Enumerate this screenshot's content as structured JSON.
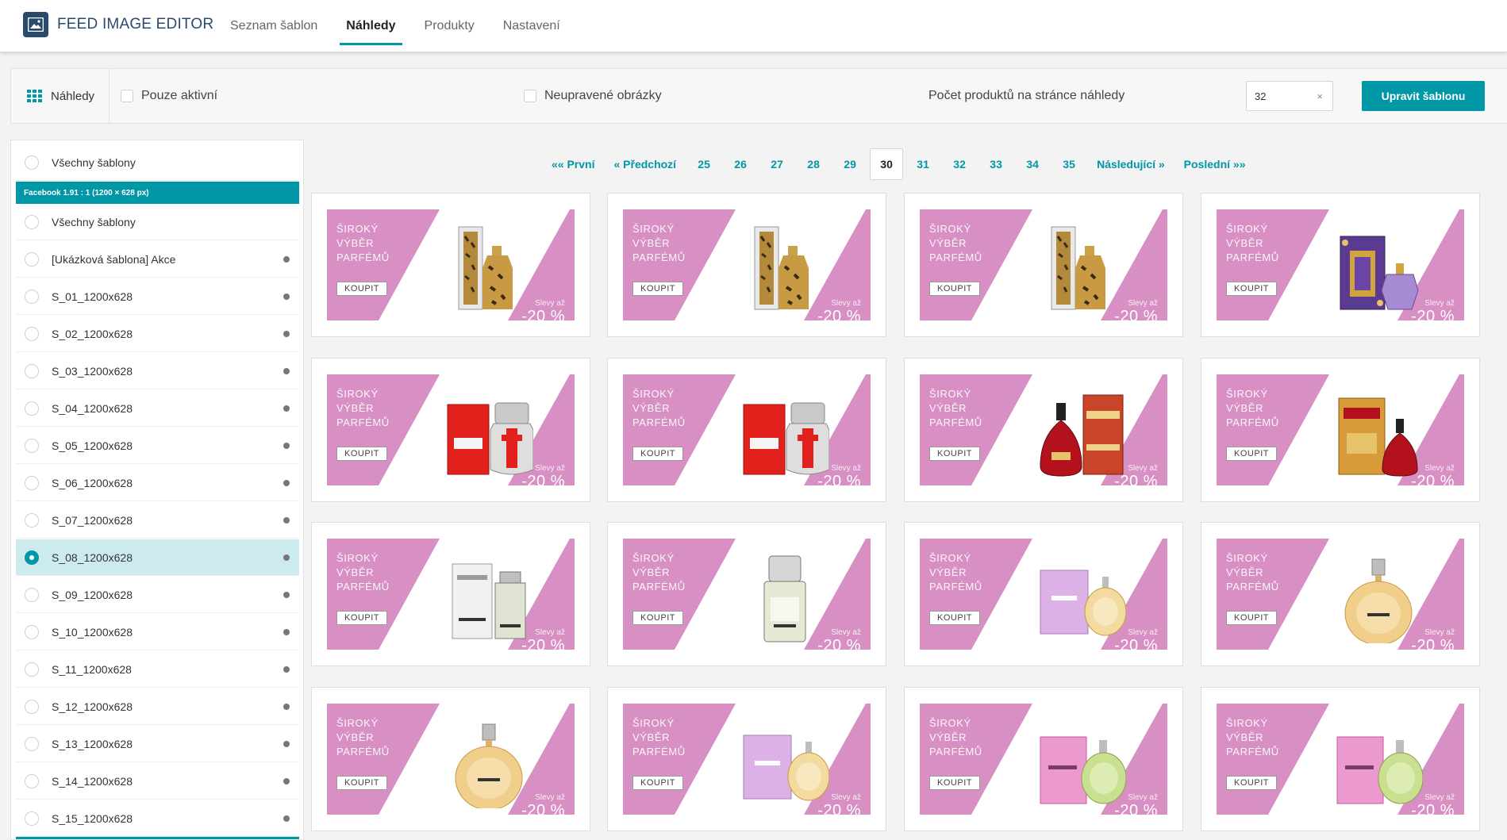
{
  "app": {
    "title": "FEED IMAGE EDITOR",
    "nav": [
      {
        "label": "Seznam šablon",
        "active": false
      },
      {
        "label": "Náhledy",
        "active": true
      },
      {
        "label": "Produkty",
        "active": false
      },
      {
        "label": "Nastavení",
        "active": false
      }
    ],
    "accent_color": "#0097a7",
    "brand_color": "#2a4a6b"
  },
  "toolbar": {
    "previews_label": "Náhledy",
    "only_active_label": "Pouze aktivní",
    "only_active_checked": false,
    "unedited_label": "Neupravené obrázky",
    "unedited_checked": false,
    "count_label": "Počet produktů na stránce náhledy",
    "count_value": "32",
    "clear_symbol": "×",
    "edit_button": "Upravit šablonu"
  },
  "sidebar": {
    "top_item": {
      "label": "Všechny šablony",
      "selected": false
    },
    "group_title": "Facebook 1.91 : 1 (1200 × 628 px)",
    "items": [
      {
        "label": "Všechny šablony",
        "selected": false,
        "dot": false
      },
      {
        "label": "[Ukázková šablona] Akce",
        "selected": false,
        "dot": true
      },
      {
        "label": "S_01_1200x628",
        "selected": false,
        "dot": true
      },
      {
        "label": "S_02_1200x628",
        "selected": false,
        "dot": true
      },
      {
        "label": "S_03_1200x628",
        "selected": false,
        "dot": true
      },
      {
        "label": "S_04_1200x628",
        "selected": false,
        "dot": true
      },
      {
        "label": "S_05_1200x628",
        "selected": false,
        "dot": true
      },
      {
        "label": "S_06_1200x628",
        "selected": false,
        "dot": true
      },
      {
        "label": "S_07_1200x628",
        "selected": false,
        "dot": true
      },
      {
        "label": "S_08_1200x628",
        "selected": true,
        "dot": true
      },
      {
        "label": "S_09_1200x628",
        "selected": false,
        "dot": true
      },
      {
        "label": "S_10_1200x628",
        "selected": false,
        "dot": true
      },
      {
        "label": "S_11_1200x628",
        "selected": false,
        "dot": true
      },
      {
        "label": "S_12_1200x628",
        "selected": false,
        "dot": true
      },
      {
        "label": "S_13_1200x628",
        "selected": false,
        "dot": true
      },
      {
        "label": "S_14_1200x628",
        "selected": false,
        "dot": true
      },
      {
        "label": "S_15_1200x628",
        "selected": false,
        "dot": true
      }
    ]
  },
  "pagination": {
    "first": "«« První",
    "prev": "« Předchozí",
    "pages": [
      "25",
      "26",
      "27",
      "28",
      "29",
      "30",
      "31",
      "32",
      "33",
      "34",
      "35"
    ],
    "current": "30",
    "next": "Následující »",
    "last": "Poslední »»"
  },
  "banner": {
    "line1": "ŠIROKÝ",
    "line2": "VÝBĚR",
    "line3": "PARFÉMŮ",
    "button": "KOUPIT",
    "small": "Slevy až",
    "percent": "-20 %",
    "pink": "#d78fc4"
  },
  "previews": [
    {
      "product": "leopard-bottle"
    },
    {
      "product": "leopard-bottle"
    },
    {
      "product": "leopard-bottle"
    },
    {
      "product": "purple-perfume-box"
    },
    {
      "product": "red-box-silver-bottle"
    },
    {
      "product": "red-box-silver-bottle"
    },
    {
      "product": "red-bottle-gold-box"
    },
    {
      "product": "gold-box-red-bottle"
    },
    {
      "product": "chanel-platinum-box"
    },
    {
      "product": "chanel-platinum-bottle"
    },
    {
      "product": "chance-pink-box"
    },
    {
      "product": "chance-round-bottle"
    },
    {
      "product": "chance-round-bottle"
    },
    {
      "product": "chance-pink-box"
    },
    {
      "product": "chance-green-box"
    },
    {
      "product": "chance-green-box"
    }
  ]
}
